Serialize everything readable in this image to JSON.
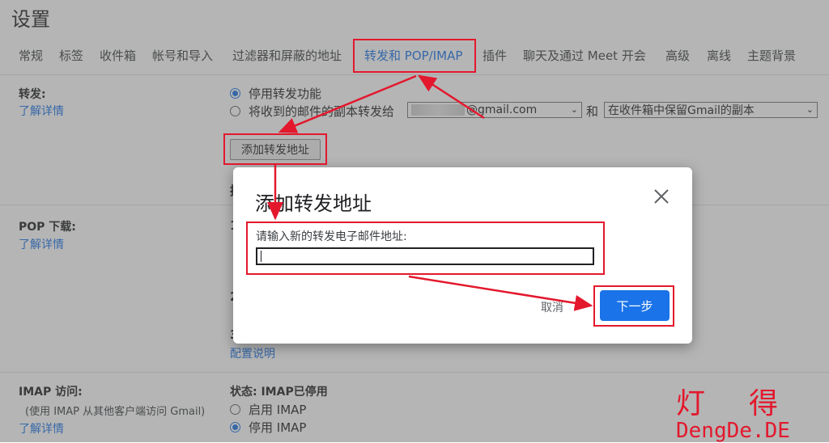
{
  "page": {
    "title": "设置"
  },
  "tabs": [
    {
      "label": "常规"
    },
    {
      "label": "标签"
    },
    {
      "label": "收件箱"
    },
    {
      "label": "帐号和导入"
    },
    {
      "label": "过滤器和屏蔽的地址"
    },
    {
      "label": "转发和 POP/IMAP",
      "active": true
    },
    {
      "label": "插件"
    },
    {
      "label": "聊天及通过 Meet 开会"
    },
    {
      "label": "高级"
    },
    {
      "label": "离线"
    },
    {
      "label": "主题背景"
    }
  ],
  "forwarding": {
    "title": "转发:",
    "learn_more": "了解详情",
    "option_disable": "停用转发功能",
    "option_forward": "将收到的邮件的副本转发给",
    "email_suffix": "@gmail.com",
    "and": "和",
    "keep_option": "在收件箱中保留Gmail的副本",
    "add_button": "添加转发地址"
  },
  "pop": {
    "title": "POP 下载:",
    "learn_more": "了解详情",
    "config_link": "配置说明"
  },
  "imap": {
    "title": "IMAP 访问:",
    "note": "(使用 IMAP 从其他客户端访问 Gmail)",
    "learn_more": "了解详情",
    "status": "状态: IMAP已停用",
    "option_enable": "启用 IMAP",
    "option_disable": "停用 IMAP"
  },
  "dialog": {
    "title": "添加转发地址",
    "label": "请输入新的转发电子邮件地址:",
    "input_value": "",
    "cancel": "取消",
    "next": "下一步"
  },
  "watermark": {
    "cn": "灯得",
    "en": "DengDe.DE"
  },
  "colors": {
    "accent": "#1a73e8",
    "annotation": "#e3182d"
  }
}
